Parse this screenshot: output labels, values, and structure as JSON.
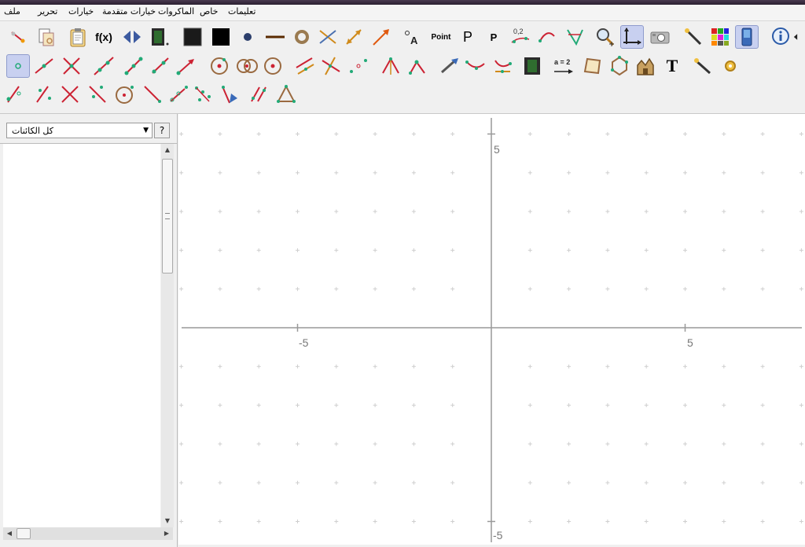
{
  "menu": [
    {
      "label": "ملف",
      "name": "menu-file"
    },
    {
      "label": "تحرير",
      "name": "menu-edit"
    },
    {
      "label": "خيارات",
      "name": "menu-options"
    },
    {
      "label": "خيارات متقدمة",
      "name": "menu-advanced-options"
    },
    {
      "label": "الماكروات",
      "name": "menu-macros"
    },
    {
      "label": "خاص",
      "name": "menu-special"
    },
    {
      "label": "تعليمات",
      "name": "menu-help"
    }
  ],
  "toolbar": {
    "text_tools": {
      "function": "f(x)",
      "point_label": "Point",
      "p_big": "P",
      "p_small": "P",
      "coords": "0,2",
      "equation": "a = 2",
      "text_tool": "T",
      "point_a": "A"
    }
  },
  "left_panel": {
    "selector_value": "كل الكائنات",
    "help_label": "?"
  },
  "canvas": {
    "x_labels": [
      "-5",
      "5"
    ],
    "y_labels": [
      "5",
      "-5"
    ]
  }
}
